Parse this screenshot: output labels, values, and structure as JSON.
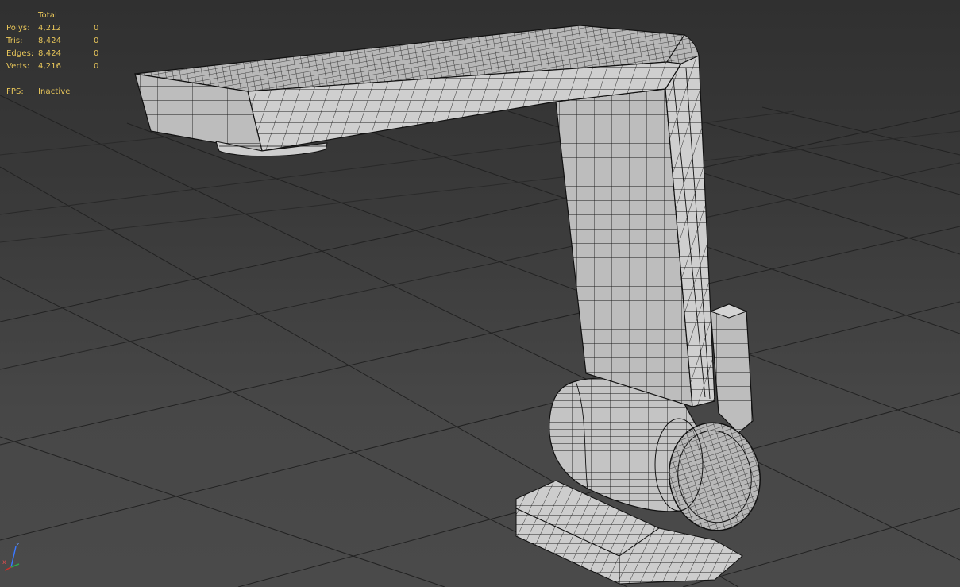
{
  "stats": {
    "header": "Total",
    "rows": [
      {
        "label": "Polys:",
        "total": "4,212",
        "selected": "0"
      },
      {
        "label": "Tris:",
        "total": "8,424",
        "selected": "0"
      },
      {
        "label": "Edges:",
        "total": "8,424",
        "selected": "0"
      },
      {
        "label": "Verts:",
        "total": "4,216",
        "selected": "0"
      }
    ],
    "fps_label": "FPS:",
    "fps_value": "Inactive"
  },
  "gizmo": {
    "axis_z": "z",
    "axis_x": "x",
    "colors": {
      "x": "#d0302a",
      "y": "#2fa84a",
      "z": "#3a78ff"
    }
  },
  "viewport": {
    "grid_color": "#1e1e1e",
    "model_face_color": "#c8c8c8",
    "model_wire_color": "#1a1a1a"
  }
}
